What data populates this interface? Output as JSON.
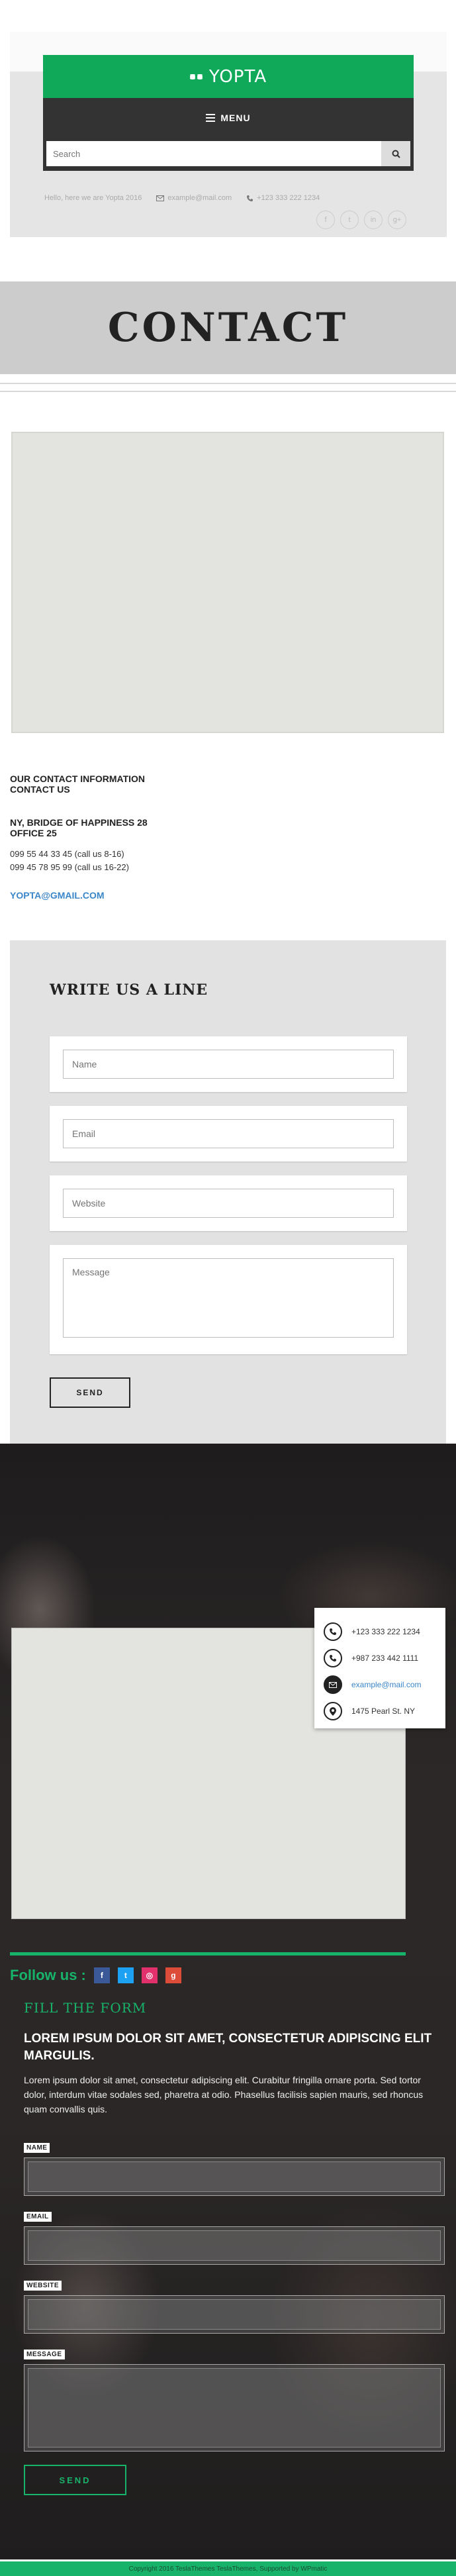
{
  "header": {
    "logo_text": "YOPTA",
    "menu_label": "MENU",
    "search_placeholder": "Search",
    "greeting": "Hello, here we are Yopta 2016",
    "email": "example@mail.com",
    "phone": "+123 333 222 1234",
    "social": [
      "f",
      "t",
      "in",
      "g+"
    ]
  },
  "page_title": "CONTACT",
  "contact_info": {
    "heading_line1": "OUR CONTACT INFORMATION",
    "heading_line2": "CONTACT US",
    "address_line1": "NY, BRIDGE OF HAPPINESS 28",
    "address_line2": "OFFICE 25",
    "phone1": "099 55 44 33 45 (call us 8-16)",
    "phone2": "099 45 78 95 99 (call us 16-22)",
    "email": "YOPTA@GMAIL.COM"
  },
  "form": {
    "title": "WRITE US A LINE",
    "name_placeholder": "Name",
    "email_placeholder": "Email",
    "website_placeholder": "Website",
    "message_placeholder": "Message",
    "send_label": "SEND"
  },
  "dark_section": {
    "info_card": {
      "phone1": "+123 333 222 1234",
      "phone2": "+987 233 442 1111",
      "email": "example@mail.com",
      "address": "1475 Pearl St. NY"
    },
    "follow_label": "Follow us :",
    "social": [
      {
        "label": "f",
        "color": "#3b5998"
      },
      {
        "label": "t",
        "color": "#1da1f2"
      },
      {
        "label": "◎",
        "color": "#e1306c"
      },
      {
        "label": "g",
        "color": "#dd4b39"
      }
    ],
    "fill_title": "FILL THE FORM",
    "lorem_heading": "LOREM IPSUM DOLOR SIT AMET, CONSECTETUR ADIPISCING ELIT MARGULIS.",
    "lorem_text": "Lorem ipsum dolor sit amet, consectetur adipiscing elit. Curabitur fringilla ornare porta. Sed tortor dolor, interdum vitae sodales sed, pharetra at odio. Phasellus facilisis sapien mauris, sed rhoncus quam convallis quis.",
    "labels": {
      "name": "NAME",
      "email": "EMAIL",
      "website": "WEBSITE",
      "message": "MESSAGE"
    },
    "send_label": "SEND"
  },
  "footer": {
    "text": "Copyright 2016 TeslaThemes TeslaThemes, Supported by WPmatic"
  },
  "colors": {
    "brand_green": "#10a95a",
    "accent_green": "#18b36a",
    "link_blue": "#3a86c8"
  }
}
